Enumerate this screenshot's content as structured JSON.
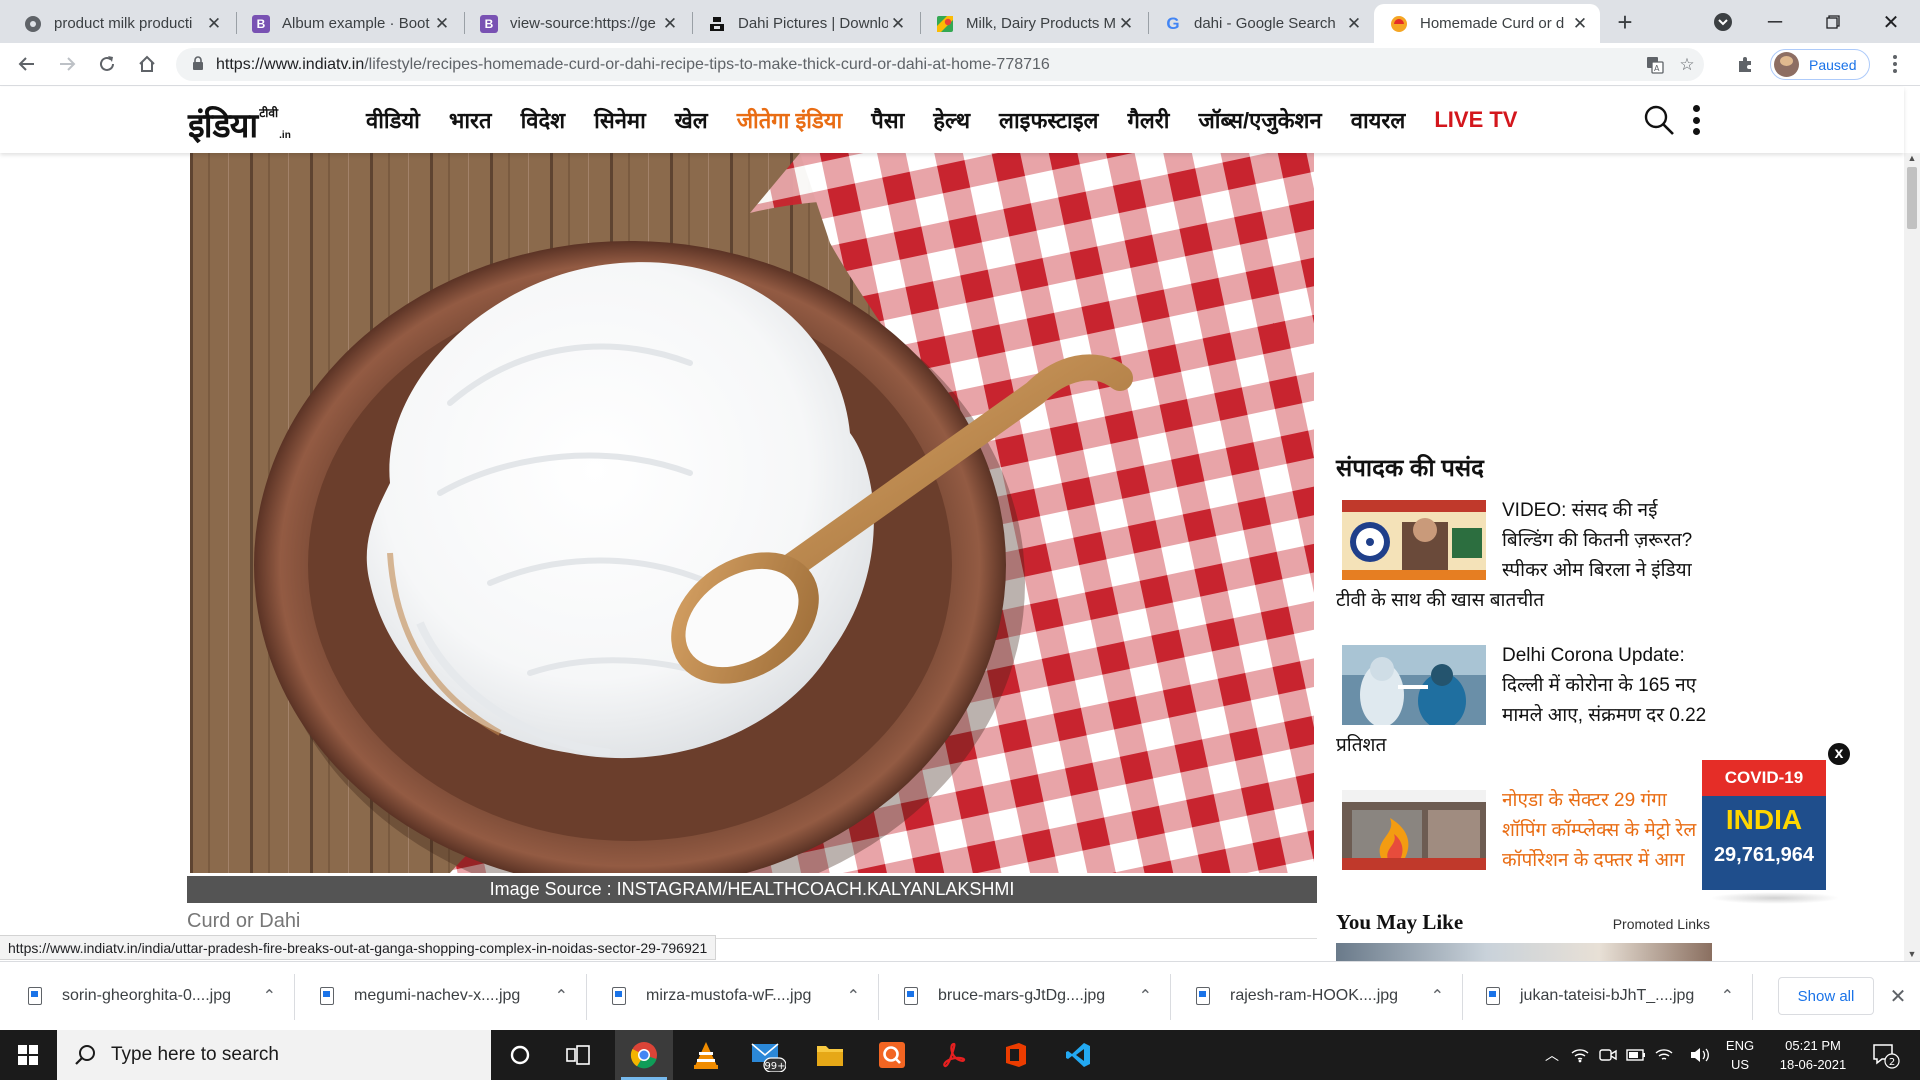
{
  "browser": {
    "tabs": [
      {
        "title": "product milk producti",
        "favicon": "globe-icon",
        "color": "#5f6368",
        "active": false
      },
      {
        "title": "Album example · Boot",
        "favicon": "bootstrap-icon",
        "color": "#7952b3",
        "glyph": "B",
        "active": false
      },
      {
        "title": "view-source:https://ge",
        "favicon": "bootstrap-icon",
        "color": "#7952b3",
        "glyph": "B",
        "active": false
      },
      {
        "title": "Dahi Pictures | Downlo",
        "favicon": "unsplash-icon",
        "color": "#111111",
        "active": false
      },
      {
        "title": "Milk, Dairy Products M",
        "favicon": "maps-icon",
        "color": "#34a853",
        "active": false
      },
      {
        "title": "dahi - Google Search",
        "favicon": "google-icon",
        "color": "#4285f4",
        "glyph": "G",
        "active": false
      },
      {
        "title": "Homemade Curd or d",
        "favicon": "indiatv-icon",
        "color": "#f5a623",
        "active": true
      }
    ],
    "new_tab_label": "+",
    "url_host": "https://www.indiatv.in",
    "url_path": "/lifestyle/recipes-homemade-curd-or-dahi-recipe-tips-to-make-thick-curd-or-dahi-at-home-778716",
    "profile_label": "Paused",
    "accent_color": "#1a73e8"
  },
  "site": {
    "logo_main": "इंडिया",
    "logo_small": "टीवी",
    "logo_suffix": ".in",
    "nav": [
      {
        "label": "वीडियो",
        "style": "normal"
      },
      {
        "label": "भारत",
        "style": "normal"
      },
      {
        "label": "विदेश",
        "style": "normal"
      },
      {
        "label": "सिनेमा",
        "style": "normal"
      },
      {
        "label": "खेल",
        "style": "normal"
      },
      {
        "label": "जीतेगा इंडिया",
        "style": "orange"
      },
      {
        "label": "पैसा",
        "style": "normal"
      },
      {
        "label": "हेल्थ",
        "style": "normal"
      },
      {
        "label": "लाइफस्टाइल",
        "style": "normal"
      },
      {
        "label": "गैलरी",
        "style": "normal"
      },
      {
        "label": "जॉब्स/एजुकेशन",
        "style": "normal"
      },
      {
        "label": "वायरल",
        "style": "normal"
      },
      {
        "label": "LIVE TV",
        "style": "red"
      }
    ],
    "brand_orange": "#e96d14",
    "brand_red": "#d3161c"
  },
  "article": {
    "image_caption": "Image Source : INSTAGRAM/HEALTHCOACH.KALYANLAKSHMI",
    "image_subject": "curd-bowl-image",
    "sub_label": "Curd or Dahi"
  },
  "sidebar": {
    "editor_title": "संपादक की पसंद",
    "editor_picks": [
      {
        "text": "VIDEO: संसद की नई बिल्डिंग की कितनी ज़रूरत? स्पीकर ओम बिरला ने इंडिया टीवी के साथ की खास बातचीत",
        "thumb": "parliament-thumb",
        "style": "normal"
      },
      {
        "text": "Delhi Corona Update: दिल्ली में कोरोना के 165 नए मामले आए, संक्रमण दर 0.22 प्रतिशत",
        "thumb": "corona-test-thumb",
        "style": "normal"
      },
      {
        "text": "नोएडा के सेक्टर 29 गंगा शॉपिंग कॉम्प्लेक्स के मेट्रो रेल कॉर्पोरेशन के दफ्तर में आग",
        "thumb": "fire-thumb",
        "style": "orange"
      }
    ],
    "you_may_like": "You May Like",
    "promoted": "Promoted Links"
  },
  "covid_widget": {
    "header": "COVID-19",
    "country": "INDIA",
    "count": "29,761,964",
    "close": "x"
  },
  "status_url": "https://www.indiatv.in/india/uttar-pradesh-fire-breaks-out-at-ganga-shopping-complex-in-noidas-sector-29-796921",
  "downloads": {
    "items": [
      {
        "name": "sorin-gheorghita-0....jpg"
      },
      {
        "name": "megumi-nachev-x....jpg"
      },
      {
        "name": "mirza-mustofa-wF....jpg"
      },
      {
        "name": "bruce-mars-gJtDg....jpg"
      },
      {
        "name": "rajesh-ram-HOOK....jpg"
      },
      {
        "name": "jukan-tateisi-bJhT_....jpg"
      }
    ],
    "show_all": "Show all"
  },
  "taskbar": {
    "search_placeholder": "Type here to search",
    "mail_badge": "99+",
    "lang_line1": "ENG",
    "lang_line2": "US",
    "time": "05:21 PM",
    "date": "18-06-2021",
    "notification_count": "2"
  }
}
